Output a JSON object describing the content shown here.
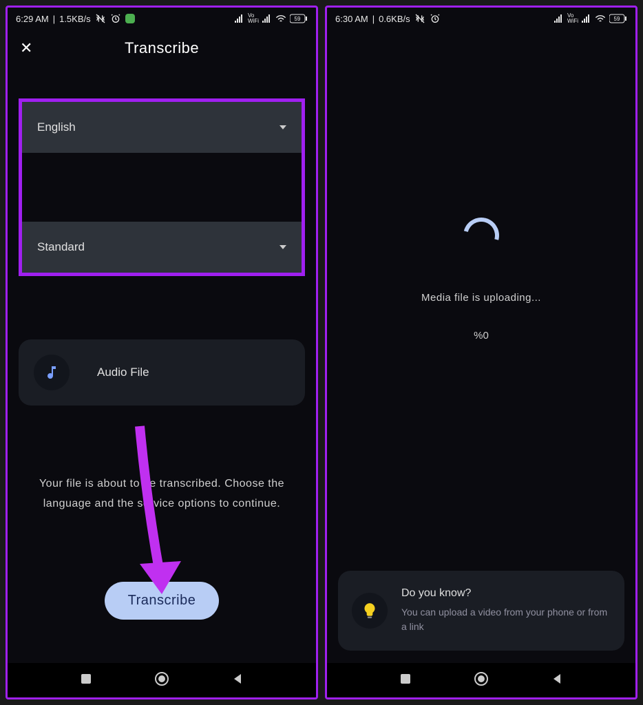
{
  "left": {
    "status": {
      "time": "6:29 AM",
      "speed": "1.5KB/s"
    },
    "header": {
      "title": "Transcribe"
    },
    "language_dropdown": {
      "value": "English"
    },
    "mode_dropdown": {
      "value": "Standard"
    },
    "audio_card": {
      "label": "Audio File"
    },
    "instruction": "Your file is about to be transcribed. Choose the language and the service options to continue.",
    "cta": "Transcribe"
  },
  "right": {
    "status": {
      "time": "6:30 AM",
      "speed": "0.6KB/s"
    },
    "loading": {
      "message": "Media file is uploading...",
      "percent": "%0"
    },
    "tip": {
      "title": "Do you know?",
      "body": "You can upload a video from your phone or from a link"
    }
  },
  "battery": "59"
}
